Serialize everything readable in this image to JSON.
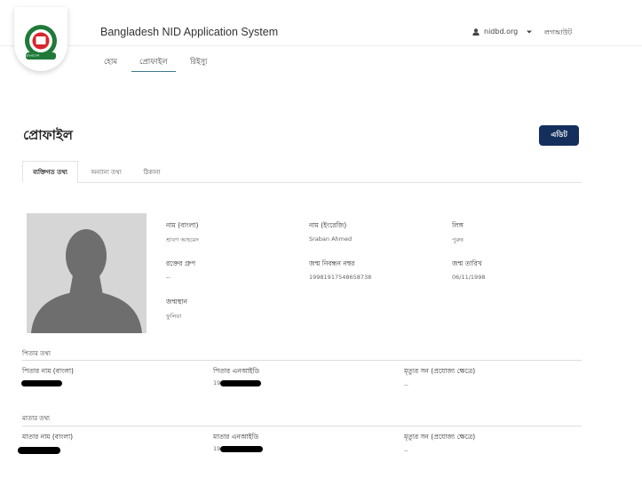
{
  "header": {
    "title": "Bangladesh NID Application System",
    "logo_text": "বাংলাদেশ",
    "user": "nidbd.org",
    "logout": "লগআউট"
  },
  "nav": {
    "items": [
      {
        "label": "হোম"
      },
      {
        "label": "প্রোফাইল"
      },
      {
        "label": "রিইস্যু"
      }
    ],
    "active": "প্রোফাইল"
  },
  "profile": {
    "title": "প্রোফাইল",
    "edit_label": "এডিট",
    "tabs": [
      {
        "label": "ব্যক্তিগত তথ্য"
      },
      {
        "label": "অন্যান্য তথ্য"
      },
      {
        "label": "ঠিকানা"
      }
    ],
    "fields": {
      "name_bn": {
        "label": "নাম (বাংলা)",
        "value": "শ্রাবণ আহমেদ"
      },
      "name_en": {
        "label": "নাম (ইংরেজি)",
        "value": "Sraban Ahmed"
      },
      "gender": {
        "label": "লিঙ্গ",
        "value": "পুরুষ"
      },
      "blood_group": {
        "label": "রক্তের গ্রুপ",
        "value": "--"
      },
      "birth_reg_no": {
        "label": "জন্ম নিবন্ধন নম্বর",
        "value": "19981917548658738"
      },
      "dob": {
        "label": "জন্ম তারিখ",
        "value": "06/11/1998"
      },
      "birthplace": {
        "label": "জন্মস্থান",
        "value": "ফুলিয়া"
      }
    }
  },
  "father": {
    "section": "পিতার তথ্য",
    "name_label": "পিতার নাম (বাংলা)",
    "nid_label": "পিতার এনআইডি",
    "nid_prefix": "19",
    "death_label": "মৃত্যুর সন (প্রযোজ্য ক্ষেত্রে)",
    "death_value": "--"
  },
  "mother": {
    "section": "মাতার তথ্য",
    "name_label": "মাতার নাম (বাংলা)",
    "nid_label": "মাতার এনআইডি",
    "nid_prefix": "19",
    "death_label": "মৃত্যুর সন (প্রযোজ্য ক্ষেত্রে)",
    "death_value": "--"
  },
  "colors": {
    "edit_button": "#142f5c",
    "nav_underline": "#3b7b8c",
    "emblem_green": "#1f7a3a",
    "emblem_red": "#d7262d"
  },
  "icons": {
    "logo": "bangladesh-emblem-icon",
    "user": "user-icon",
    "dropdown": "caret-down-icon",
    "avatar": "person-placeholder-icon"
  }
}
